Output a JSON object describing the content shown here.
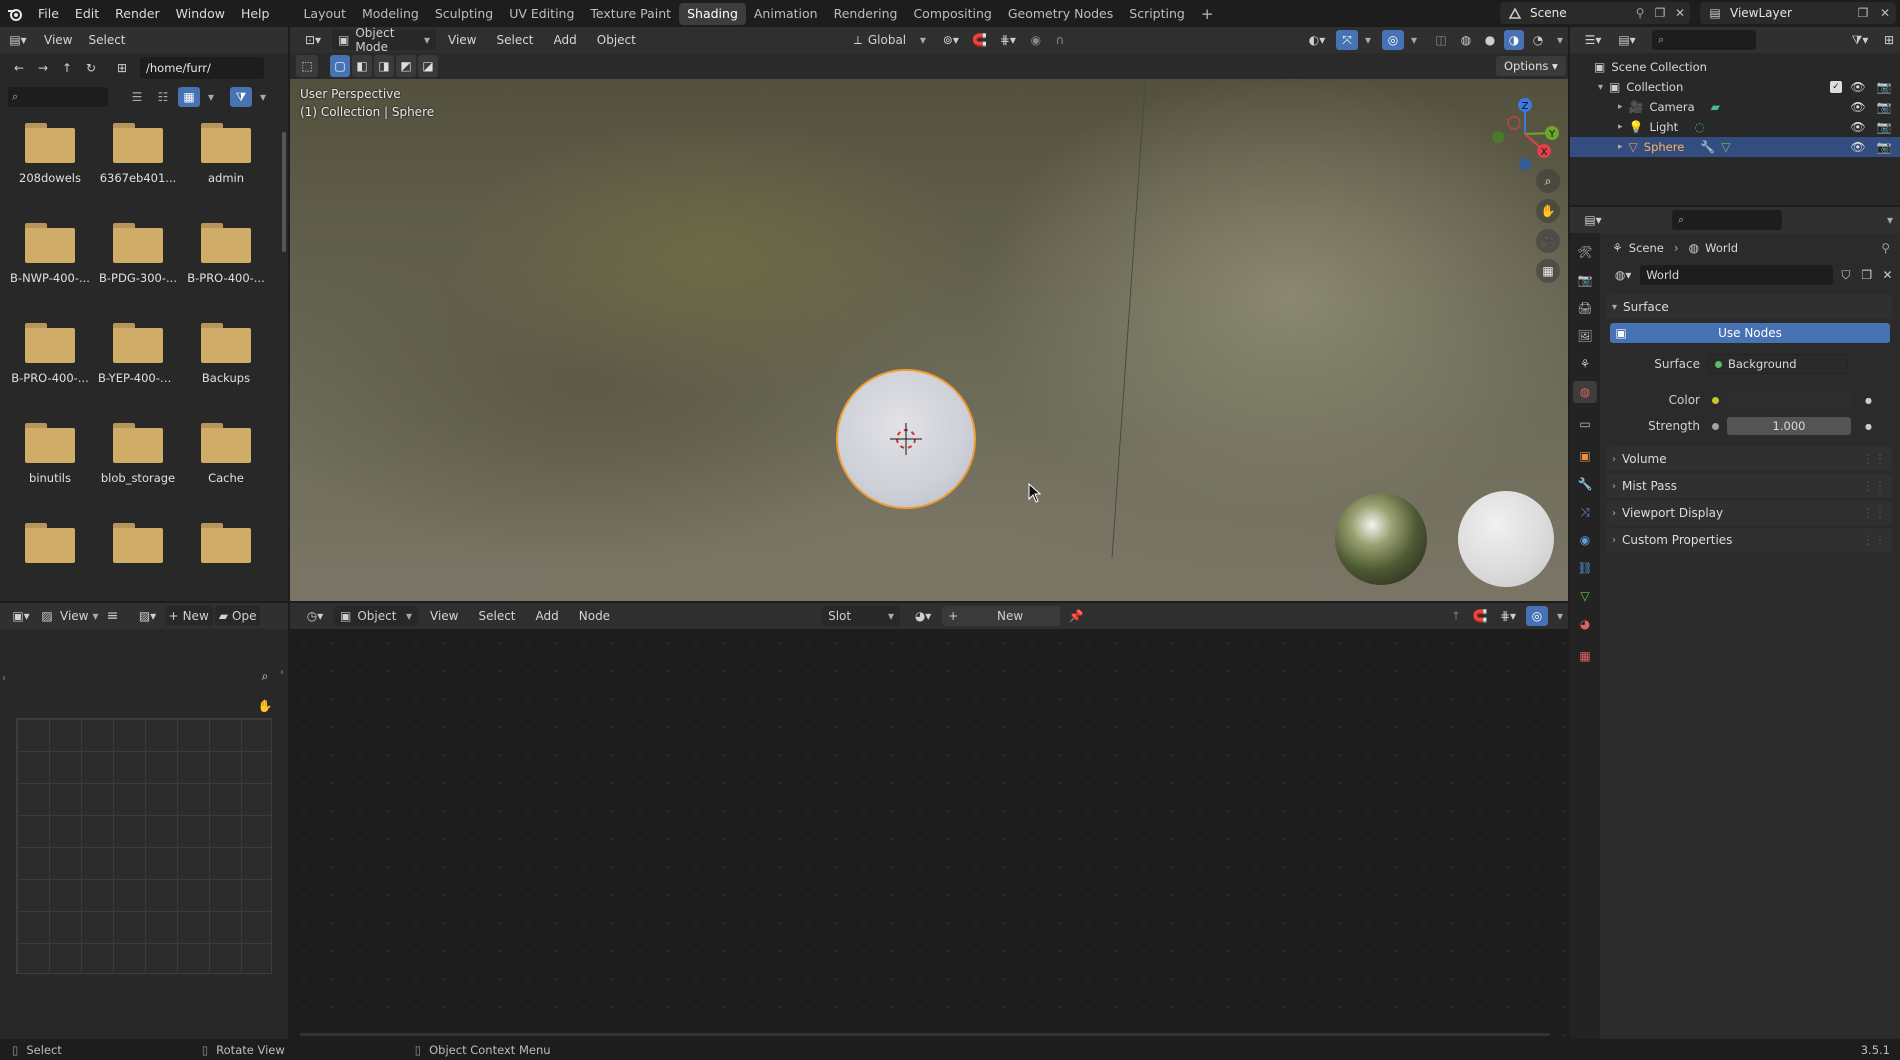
{
  "topbar": {
    "menus": [
      "File",
      "Edit",
      "Render",
      "Window",
      "Help"
    ],
    "workspaces": [
      "Layout",
      "Modeling",
      "Sculpting",
      "UV Editing",
      "Texture Paint",
      "Shading",
      "Animation",
      "Rendering",
      "Compositing",
      "Geometry Nodes",
      "Scripting"
    ],
    "active_workspace": "Shading",
    "add_tab": "+",
    "scene_name": "Scene",
    "view_layer": "ViewLayer"
  },
  "file_browser": {
    "menus": [
      "View",
      "Select"
    ],
    "path": "/home/furr/",
    "search_placeholder": "",
    "folders": [
      "208dowels",
      "6367eb401...",
      "admin",
      "B-NWP-400-...",
      "B-PDG-300-...",
      "B-PRO-400-...",
      "B-PRO-400-...",
      "B-YEP-400-R...",
      "Backups",
      "binutils",
      "blob_storage",
      "Cache",
      "",
      "",
      ""
    ]
  },
  "viewport": {
    "mode": "Object Mode",
    "menus": [
      "View",
      "Select",
      "Add",
      "Object"
    ],
    "transform": "Global",
    "options": "Options",
    "info_line1": "User Perspective",
    "info_line2": "(1) Collection | Sphere",
    "gizmo": {
      "x": "X",
      "y": "Y",
      "z": "Z"
    }
  },
  "image_editor": {
    "view": "View",
    "new": "New",
    "open": "Ope"
  },
  "node_editor": {
    "object": "Object",
    "menus": [
      "View",
      "Select",
      "Add",
      "Node"
    ],
    "slot": "Slot",
    "new": "New"
  },
  "outliner": {
    "scene_collection": "Scene Collection",
    "collection": "Collection",
    "items": [
      {
        "name": "Camera",
        "selected": false
      },
      {
        "name": "Light",
        "selected": false
      },
      {
        "name": "Sphere",
        "selected": true
      }
    ]
  },
  "properties": {
    "breadcrumb_scene": "Scene",
    "breadcrumb_world": "World",
    "world_name": "World",
    "surface_section": "Surface",
    "use_nodes": "Use Nodes",
    "surface_label": "Surface",
    "surface_value": "Background",
    "color_label": "Color",
    "strength_label": "Strength",
    "strength_value": "1.000",
    "sections": [
      "Volume",
      "Mist Pass",
      "Viewport Display",
      "Custom Properties"
    ]
  },
  "statusbar": {
    "select": "Select",
    "rotate": "Rotate View",
    "context": "Object Context Menu",
    "version": "3.5.1"
  },
  "colors": {
    "accent_blue": "#4772b3",
    "selection_orange": "#f29d33",
    "folder_tan": "#c9a864",
    "outliner_selected": "#334d80"
  }
}
